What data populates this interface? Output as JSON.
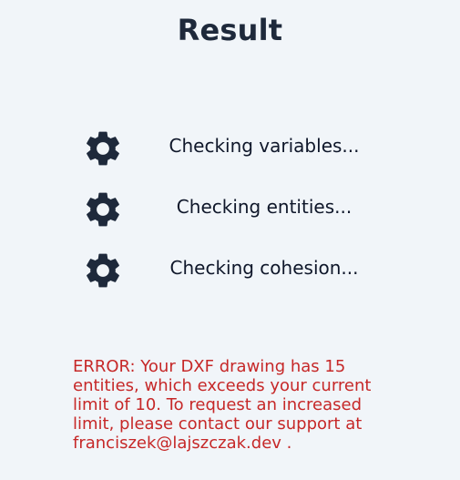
{
  "header": {
    "title": "Result"
  },
  "checks": [
    {
      "label": "Checking variables...",
      "icon": "gear-icon"
    },
    {
      "label": "Checking entities...",
      "icon": "gear-icon"
    },
    {
      "label": "Checking cohesion...",
      "icon": "gear-icon"
    }
  ],
  "error": {
    "message": "ERROR: Your DXF drawing has 15 entities, which exceeds your current limit of 10. To request an increased limit, please contact our support at franciszek@lajszczak.dev ."
  },
  "colors": {
    "background": "#f1f5f9",
    "icon": "#1e293b",
    "text": "#0f172a",
    "error": "#c62828"
  }
}
